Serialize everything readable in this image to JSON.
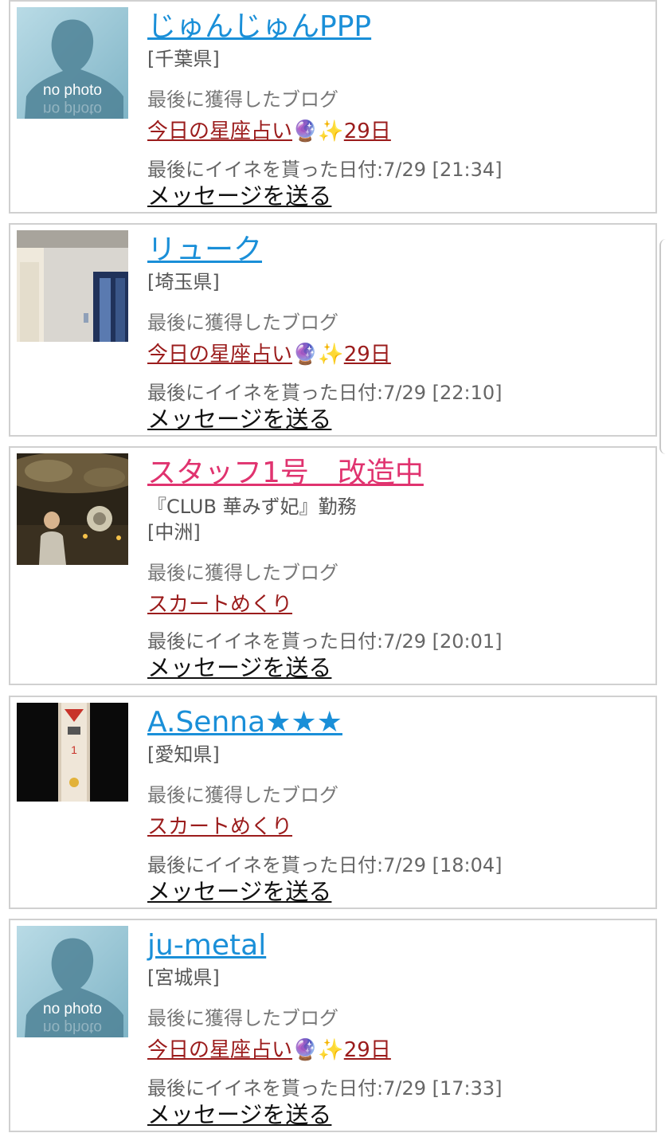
{
  "labels": {
    "last_blog": "最後に獲得したブログ",
    "send_message": "メッセージを送る",
    "no_photo": "no photo"
  },
  "users": [
    {
      "name": "じゅんじゅんPPP",
      "pref": "[千葉県]",
      "blog": "今日の星座占い",
      "blog_emoji1": "🔮",
      "blog_emoji2": "✨",
      "blog_suffix": "29日",
      "like": "最後にイイネを貰った日付:7/29 [21:34]"
    },
    {
      "name": "リューク",
      "pref": "[埼玉県]",
      "blog": "今日の星座占い",
      "blog_emoji1": "🔮",
      "blog_emoji2": "✨",
      "blog_suffix": "29日",
      "like": "最後にイイネを貰った日付:7/29 [22:10]"
    },
    {
      "name": "スタッフ1号　改造中",
      "shop": "『CLUB 華みず妃』勤務",
      "pref": "[中洲]",
      "blog": "スカートめくり",
      "like": "最後にイイネを貰った日付:7/29 [20:01]"
    },
    {
      "name": "A.Senna★★★",
      "pref": "[愛知県]",
      "blog": "スカートめくり",
      "like": "最後にイイネを貰った日付:7/29 [18:04]"
    },
    {
      "name": "ju-metal",
      "pref": "[宮城県]",
      "blog": "今日の星座占い",
      "blog_emoji1": "🔮",
      "blog_emoji2": "✨",
      "blog_suffix": "29日",
      "like": "最後にイイネを貰った日付:7/29 [17:33]"
    }
  ],
  "colors": {
    "name_link": "#1a8fd8",
    "staff_name": "#e0336f",
    "blog_link": "#9b1c1c"
  }
}
